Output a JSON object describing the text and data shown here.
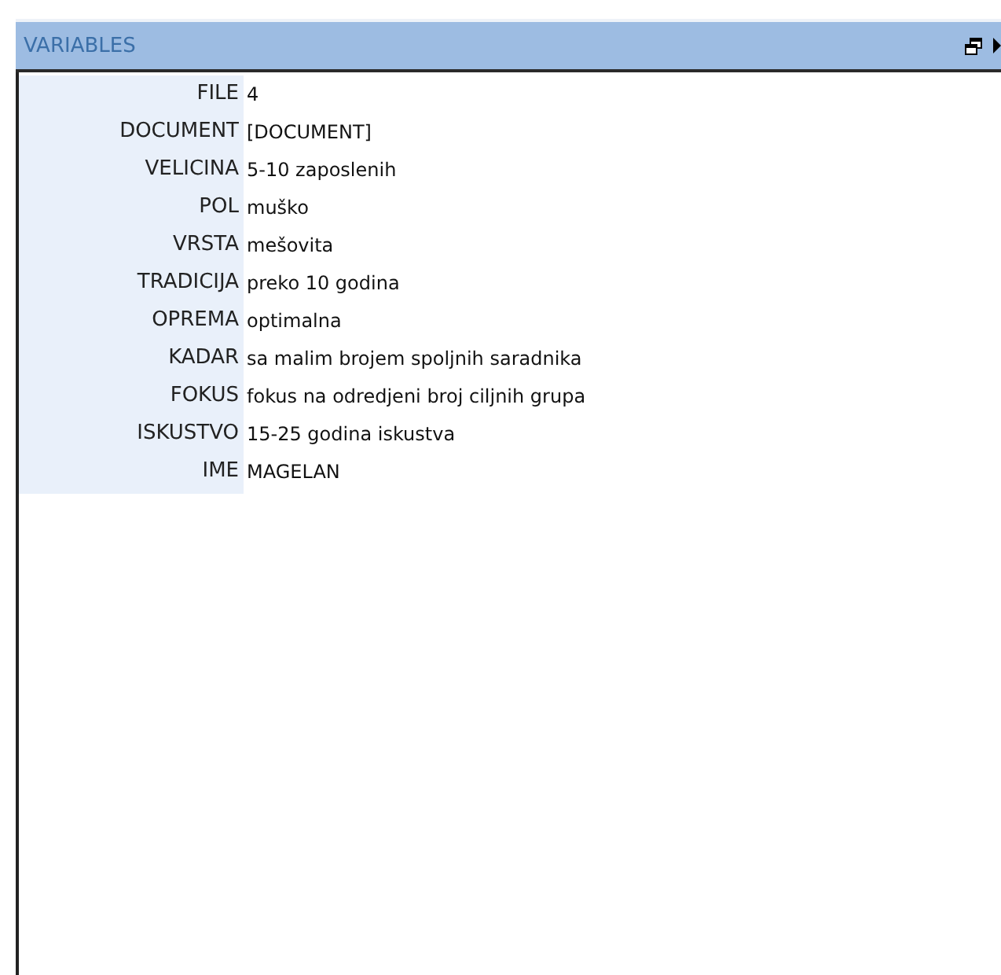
{
  "panel": {
    "title": "VARIABLES"
  },
  "variables": [
    {
      "name": "FILE",
      "value": "4"
    },
    {
      "name": "DOCUMENT",
      "value": "[DOCUMENT]"
    },
    {
      "name": "VELICINA",
      "value": "5-10 zaposlenih"
    },
    {
      "name": "POL",
      "value": "muško"
    },
    {
      "name": "VRSTA",
      "value": "mešovita"
    },
    {
      "name": "TRADICIJA",
      "value": "preko 10 godina"
    },
    {
      "name": "OPREMA",
      "value": "optimalna"
    },
    {
      "name": "KADAR",
      "value": "sa malim brojem spoljnih saradnika"
    },
    {
      "name": "FOKUS",
      "value": "fokus na odredjeni broj ciljnih grupa"
    },
    {
      "name": "ISKUSTVO",
      "value": "15-25 godina iskustva"
    },
    {
      "name": "IME",
      "value": "MAGELAN"
    }
  ]
}
